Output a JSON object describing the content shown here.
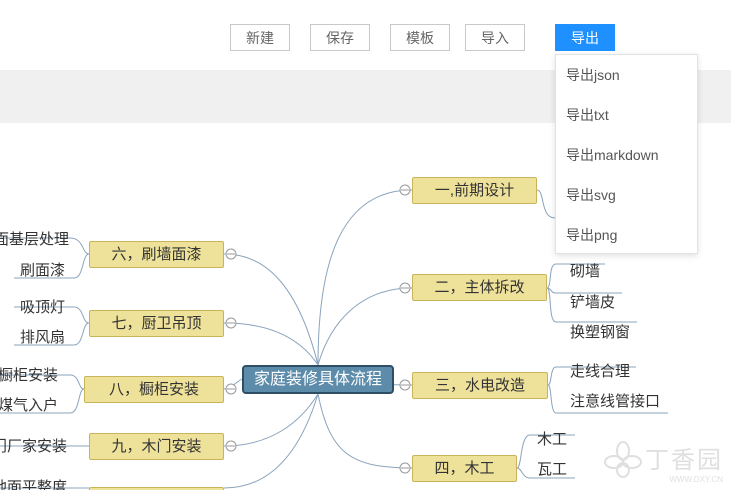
{
  "toolbar": {
    "buttons": [
      "新建",
      "保存",
      "模板",
      "导入",
      "导出"
    ]
  },
  "export_menu": {
    "items": [
      "导出json",
      "导出txt",
      "导出markdown",
      "导出svg",
      "导出png"
    ]
  },
  "mindmap": {
    "root": "家庭装修具体流程",
    "right": [
      {
        "label": "一,前期设计",
        "children": []
      },
      {
        "label": "二，主体拆改",
        "children": [
          "砌墙",
          "铲墙皮",
          "换塑钢窗"
        ]
      },
      {
        "label": "三，水电改造",
        "children": [
          "走线合理",
          "注意线管接口"
        ]
      },
      {
        "label": "四，木工",
        "children": [
          "木工",
          "瓦工"
        ]
      }
    ],
    "left": [
      {
        "label": "六，刷墙面漆",
        "children": [
          "面基层处理",
          "刷面漆"
        ]
      },
      {
        "label": "七，厨卫吊顶",
        "children": [
          "吸顶灯",
          "排风扇"
        ]
      },
      {
        "label": "八，橱柜安装",
        "children": [
          "橱柜安装",
          "煤气入户"
        ]
      },
      {
        "label": "九，木门安装",
        "children": [
          "门厂家安装"
        ]
      },
      {
        "label": "",
        "children": [
          "地面平整度"
        ]
      }
    ]
  },
  "watermark": {
    "cn": "丁香园",
    "en": "WWW.DXY.CN"
  },
  "colors": {
    "accent": "#1e90ff",
    "node_fill": "#eee19a",
    "root_fill": "#5d8cab",
    "link": "#8aa4bd"
  }
}
